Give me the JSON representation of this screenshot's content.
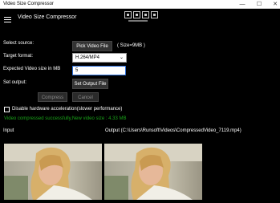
{
  "window": {
    "title": "Video Size Compressor",
    "minimize_glyph": "—",
    "maximize_glyph": "☐",
    "close_glyph": "✕"
  },
  "app": {
    "title": "Video Size Compressor"
  },
  "toolbar": {
    "icons": [
      "crop-icon",
      "save-icon",
      "screen-icon",
      "share-icon"
    ]
  },
  "form": {
    "select_source_label": "Select source:",
    "pick_video_button": "Pick Video File",
    "size_info": "( Size=9MB )",
    "target_format_label": "Target format:",
    "target_format_value": "H.264/MP4",
    "expected_size_label": "Expected Video size in MB",
    "expected_size_value": "5",
    "set_output_label": "Set output:",
    "set_output_button": "Set Output File",
    "compress_button": "Compress",
    "cancel_button": "Cancel",
    "hw_accel_label": "Disable hardware acceleration(slower performance)",
    "status_text": "Video compressed successfully,New video size : 4.33 MB"
  },
  "preview": {
    "input_label": "Input",
    "output_label": "Output (C:\\Users\\Runsoft\\Videos\\CompressedVideo_7119.mp4)"
  },
  "colors": {
    "background": "#000000",
    "status": "#19a319",
    "focus_border": "#2a6cd6"
  }
}
